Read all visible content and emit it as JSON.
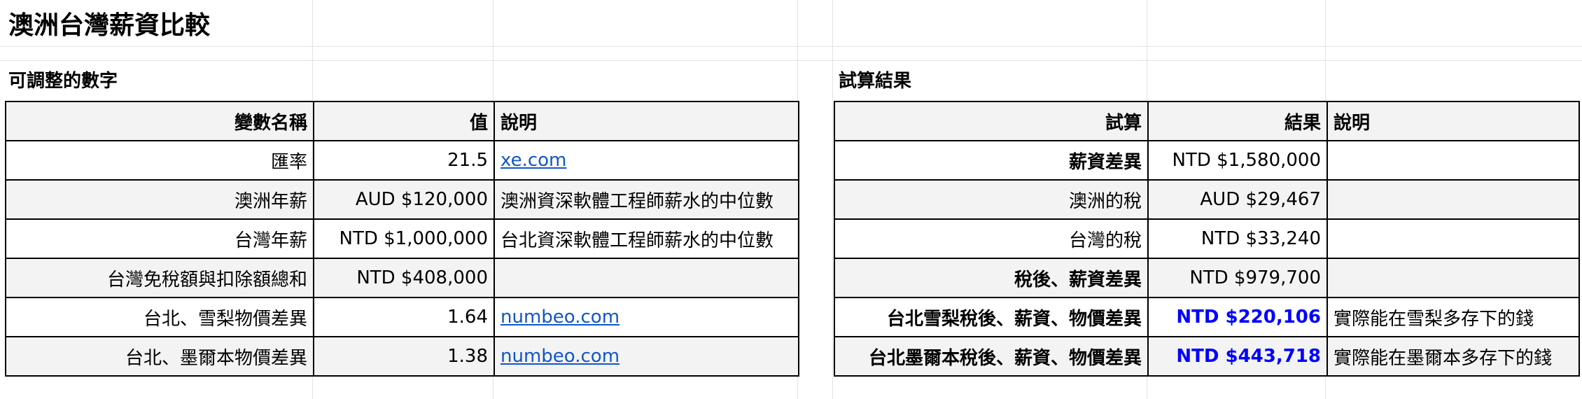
{
  "title": "澳洲台灣薪資比較",
  "left_section": {
    "title": "可調整的數字",
    "headers": [
      "變數名稱",
      "值",
      "說明"
    ],
    "rows": [
      {
        "name": "匯率",
        "value": "21.5",
        "note": "xe.com"
      },
      {
        "name": "澳洲年薪",
        "value": "AUD $120,000",
        "note": "澳洲資深軟體工程師薪水的中位數"
      },
      {
        "name": "台灣年薪",
        "value": "NTD $1,000,000",
        "note": "台北資深軟體工程師薪水的中位數"
      },
      {
        "name": "台灣免稅額與扣除額總和",
        "value": "NTD $408,000",
        "note": ""
      },
      {
        "name": "台北、雪梨物價差異",
        "value": "1.64",
        "note": "numbeo.com"
      },
      {
        "name": "台北、墨爾本物價差異",
        "value": "1.38",
        "note": "numbeo.com"
      }
    ]
  },
  "right_section": {
    "title": "試算結果",
    "headers": [
      "試算",
      "結果",
      "說明"
    ],
    "rows": [
      {
        "name": "薪資差異",
        "value": "NTD $1,580,000",
        "note": ""
      },
      {
        "name": "澳洲的稅",
        "value": "AUD $29,467",
        "note": ""
      },
      {
        "name": "台灣的稅",
        "value": "NTD $33,240",
        "note": ""
      },
      {
        "name": "稅後、薪資差異",
        "value": "NTD $979,700",
        "note": ""
      },
      {
        "name": "台北雪梨稅後、薪資、物價差異",
        "value": "NTD $220,106",
        "note": "實際能在雪梨多存下的錢"
      },
      {
        "name": "台北墨爾本稅後、薪資、物價差異",
        "value": "NTD $443,718",
        "note": "實際能在墨爾本多存下的錢"
      }
    ]
  },
  "colors": {
    "link": "#1155cc",
    "highlight_value": "#0000ff",
    "header_bg": "#f3f3f3",
    "gridline": "#e2e3e3"
  }
}
